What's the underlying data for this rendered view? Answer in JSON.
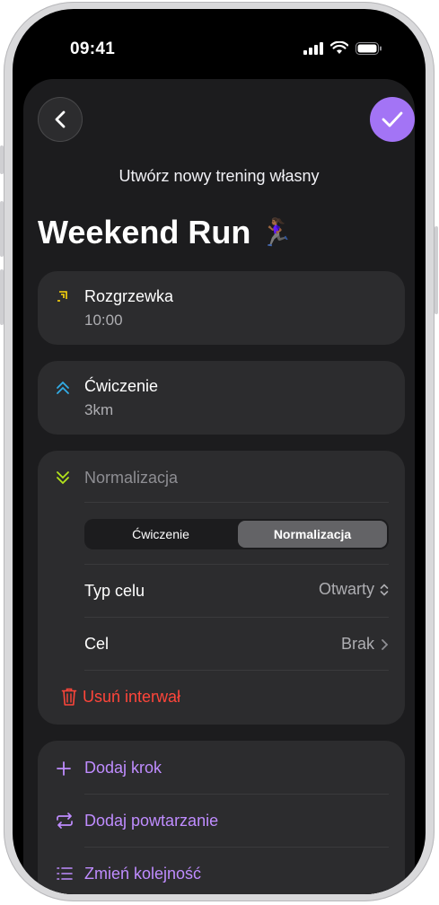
{
  "status": {
    "time": "09:41"
  },
  "header": {
    "subtitle": "Utwórz nowy trening własny",
    "title": "Weekend Run",
    "title_emoji": "🏃🏾‍♀️"
  },
  "steps": [
    {
      "name": "Rozgrzewka",
      "value": "10:00",
      "icon": "warmup-icon",
      "color": "#ffd60a"
    },
    {
      "name": "Ćwiczenie",
      "value": "3km",
      "icon": "work-chevrons-up-icon",
      "color": "#32ade6"
    }
  ],
  "editing": {
    "name": "Normalizacja",
    "icon": "cooldown-chevrons-down-icon",
    "color": "#b4e51c",
    "segment": {
      "options": [
        "Ćwiczenie",
        "Normalizacja"
      ],
      "selected": "Normalizacja"
    },
    "rows": [
      {
        "label": "Typ celu",
        "value": "Otwarty"
      },
      {
        "label": "Cel",
        "value": "Brak"
      }
    ],
    "delete_label": "Usuń interwał"
  },
  "actions": [
    {
      "label": "Dodaj krok",
      "icon": "plus-icon"
    },
    {
      "label": "Dodaj powtarzanie",
      "icon": "repeat-icon"
    },
    {
      "label": "Zmień kolejność",
      "icon": "list-icon"
    }
  ],
  "colors": {
    "accent": "#a374f5",
    "action": "#bf8cff",
    "destructive": "#ff453a",
    "card": "#2c2c2e",
    "sheet": "#1c1c1e"
  }
}
